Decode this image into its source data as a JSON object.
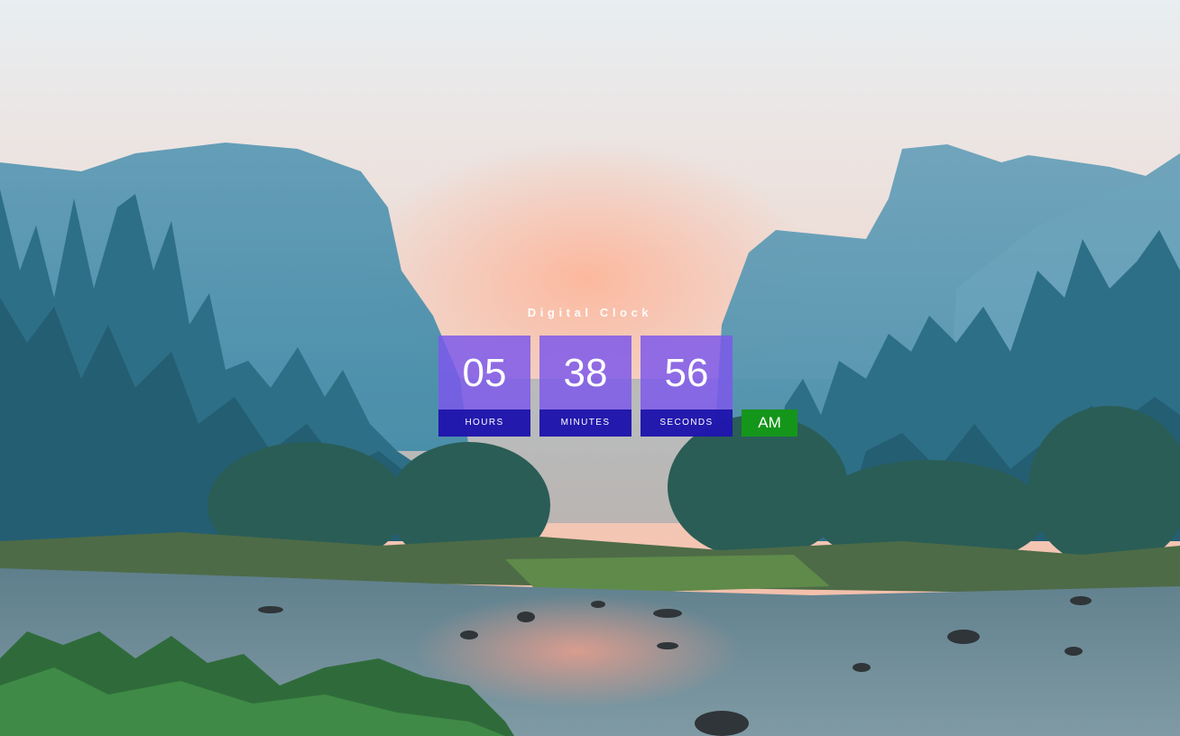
{
  "clock": {
    "title": "Digital Clock",
    "hours": "05",
    "minutes": "38",
    "seconds": "56",
    "hours_label": "HOURS",
    "minutes_label": "MINUTES",
    "seconds_label": "SECONDS",
    "period": "AM"
  },
  "colors": {
    "tile": "#7c58eb",
    "tile_label": "#160ea5",
    "period_badge": "#14961a",
    "sky_top": "#e9eef0",
    "sky_glow": "#f5b79c",
    "mountain": "#5f9bb3",
    "forest": "#2f7288",
    "river": "#6f8f9b"
  },
  "background": {
    "icon": "mountain-valley-landscape-image"
  }
}
